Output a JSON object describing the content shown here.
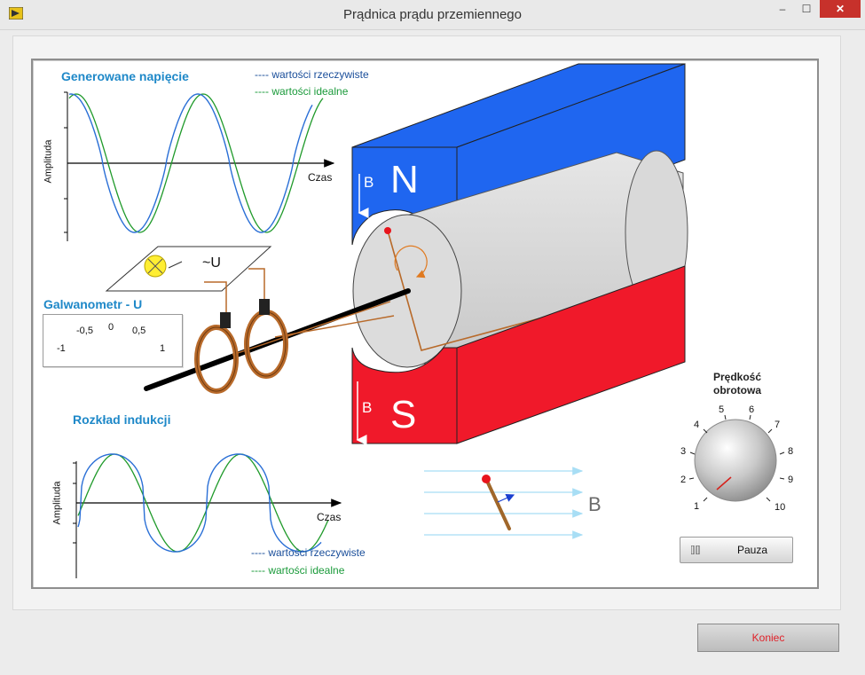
{
  "window": {
    "title": "Prądnica prądu przemiennego",
    "minimize": "–",
    "maximize": "☐",
    "close": "✕"
  },
  "voltage_plot": {
    "title": "Generowane napięcie",
    "legend_real": "---- wartości rzeczywiste",
    "legend_ideal": "---- wartości idealne",
    "ylabel": "Amplituda",
    "xlabel": "Czas",
    "color_real": "#2a6fd6",
    "color_ideal": "#1f9a2a"
  },
  "induction_plot": {
    "title": "Rozkład indukcji",
    "legend_real": "---- wartości rzeczywiste",
    "legend_ideal": "---- wartości idealne",
    "ylabel": "Amplituda",
    "xlabel": "Czas"
  },
  "galvanometer": {
    "title": "Galwanometr - U",
    "ticks": [
      "-1",
      "-0,5",
      "0",
      "0,5",
      "1"
    ],
    "value": 1
  },
  "generator": {
    "pole_n": "N",
    "pole_s": "S",
    "field_label_top": "B",
    "field_label_bottom": "B",
    "voltage_label": "~U",
    "vector_field_label": "B",
    "color_north": "#1f66f0",
    "color_south": "#f0192a",
    "color_rotor": "#d6d6d6"
  },
  "speed_knob": {
    "title_line1": "Prędkość",
    "title_line2": "obrotowa",
    "ticks": [
      "1",
      "2",
      "3",
      "4",
      "5",
      "6",
      "7",
      "8",
      "9",
      "10"
    ],
    "value": 1.3
  },
  "pause_button": {
    "label": "Pauza"
  },
  "exit_button": {
    "label": "Koniec",
    "color": "#e0222a"
  }
}
